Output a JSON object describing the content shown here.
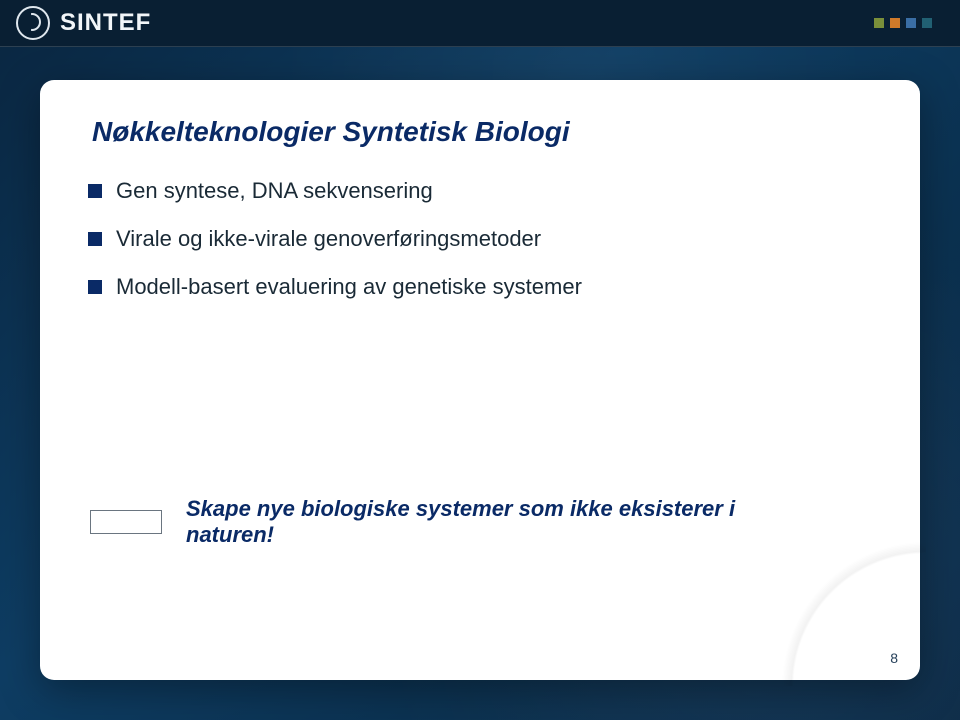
{
  "brand": {
    "name": "SINTEF"
  },
  "accent_dots": [
    "#7a8f3a",
    "#d07a2a",
    "#3a6ea5",
    "#216073"
  ],
  "slide": {
    "title": "Nøkkelteknologier Syntetisk Biologi",
    "bullets": [
      "Gen syntese, DNA sekvensering",
      "Virale og ikke-virale genoverføringsmetoder",
      "Modell-basert evaluering av genetiske systemer"
    ],
    "callout": "Skape nye biologiske systemer som ikke eksisterer i naturen!",
    "page_number": "8"
  }
}
